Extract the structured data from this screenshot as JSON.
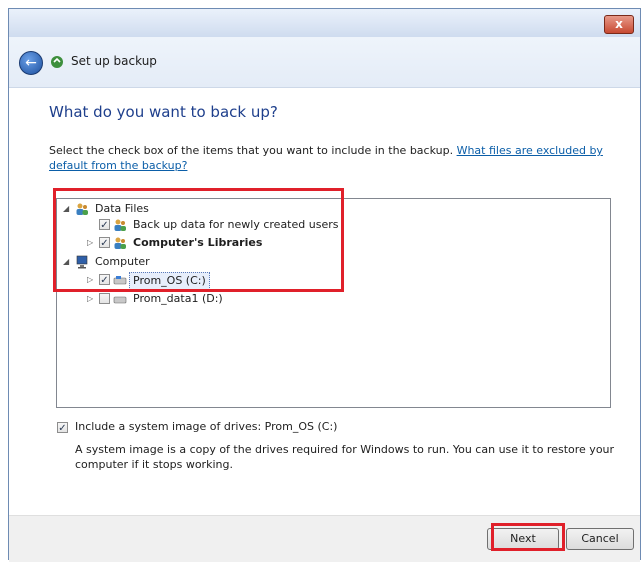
{
  "window": {
    "close_label": "x"
  },
  "header": {
    "title": "Set up backup"
  },
  "page": {
    "title": "What do you want to back up?",
    "description": "Select the check box of the items that you want to include in the backup. ",
    "link": "What files are excluded by default from the backup?"
  },
  "tree": {
    "data_files": {
      "label": "Data Files"
    },
    "new_users": {
      "label": "Back up data for newly created users"
    },
    "libraries": {
      "label": "Computer's Libraries"
    },
    "computer": {
      "label": "Computer"
    },
    "prom_os": {
      "label": "Prom_OS (C:)"
    },
    "prom_data": {
      "label": "Prom_data1 (D:)"
    }
  },
  "system_image": {
    "label": "Include a system image of drives: Prom_OS (C:)",
    "description": "A system image is a copy of the drives required for Windows to run. You can use it to restore your computer if it stops working."
  },
  "footer": {
    "next_label": "Next",
    "cancel_label": "Cancel"
  },
  "colors": {
    "highlight": "#e0202a",
    "title": "#1e3f8c",
    "link": "#0b5ea8"
  }
}
